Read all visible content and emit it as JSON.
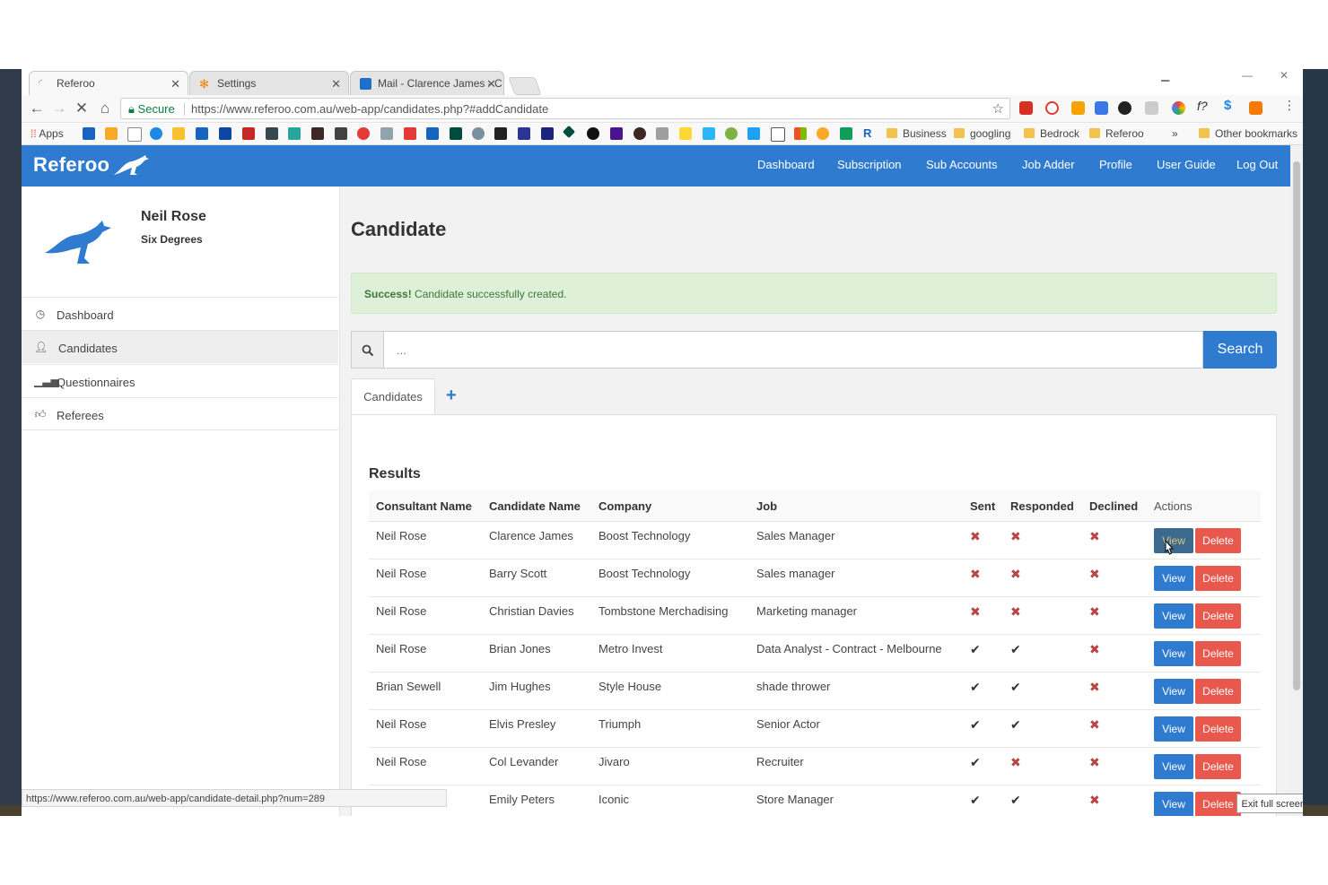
{
  "browser": {
    "tabs": [
      {
        "title": "Referoo",
        "active": true
      },
      {
        "title": "Settings",
        "active": false
      },
      {
        "title": "Mail - Clarence James - C",
        "active": false
      }
    ],
    "secure_label": "Secure",
    "url": "https://www.referoo.com.au/web-app/candidates.php?#addCandidate",
    "bookmarks": {
      "apps_label": "Apps",
      "folders": [
        "Business",
        "googling",
        "Bedrock",
        "Referoo"
      ],
      "overflow": "»",
      "other": "Other bookmarks"
    },
    "status_url": "https://www.referoo.com.au/web-app/candidate-detail.php?num=289",
    "exit_fullscreen": "Exit full screen (f)"
  },
  "app": {
    "logo_text": "Referoo",
    "brand_color": "#2e7bcf",
    "nav": [
      "Dashboard",
      "Subscription",
      "Sub Accounts",
      "Job Adder",
      "Profile",
      "User Guide",
      "Log Out"
    ]
  },
  "sidebar": {
    "user_name": "Neil Rose",
    "user_org": "Six Degrees",
    "items": [
      {
        "label": "Dashboard",
        "icon": "dashboard-icon",
        "active": false
      },
      {
        "label": "Candidates",
        "icon": "user-icon",
        "active": true
      },
      {
        "label": "Questionnaires",
        "icon": "bar-chart-icon",
        "active": false
      },
      {
        "label": "Referees",
        "icon": "thumbs-up-icon",
        "active": false
      }
    ]
  },
  "main": {
    "title": "Candidate",
    "alert": {
      "strong": "Success!",
      "text": " Candidate successfully created."
    },
    "search": {
      "placeholder": "...",
      "button": "Search"
    },
    "tab_label": "Candidates",
    "add_tab": "+",
    "results_title": "Results",
    "columns": [
      "Consultant Name",
      "Candidate Name",
      "Company",
      "Job",
      "Sent",
      "Responded",
      "Declined",
      "Actions"
    ],
    "view_label": "View",
    "delete_label": "Delete",
    "rows": [
      {
        "consultant": "Neil Rose",
        "candidate": "Clarence James",
        "company": "Boost Technology",
        "job": "Sales Manager",
        "sent": false,
        "responded": false,
        "declined": false
      },
      {
        "consultant": "Neil Rose",
        "candidate": "Barry Scott",
        "company": "Boost Technology",
        "job": "Sales manager",
        "sent": false,
        "responded": false,
        "declined": false
      },
      {
        "consultant": "Neil Rose",
        "candidate": "Christian Davies",
        "company": "Tombstone Merchadising",
        "job": "Marketing manager",
        "sent": false,
        "responded": false,
        "declined": false
      },
      {
        "consultant": "Neil Rose",
        "candidate": "Brian Jones",
        "company": "Metro Invest",
        "job": "Data Analyst - Contract - Melbourne",
        "sent": true,
        "responded": true,
        "declined": false
      },
      {
        "consultant": "Brian Sewell",
        "candidate": "Jim Hughes",
        "company": "Style House",
        "job": "shade thrower",
        "sent": true,
        "responded": true,
        "declined": false
      },
      {
        "consultant": "Neil Rose",
        "candidate": "Elvis Presley",
        "company": "Triumph",
        "job": "Senior Actor",
        "sent": true,
        "responded": true,
        "declined": false
      },
      {
        "consultant": "Neil Rose",
        "candidate": "Col Levander",
        "company": "Jivaro",
        "job": "Recruiter",
        "sent": true,
        "responded": false,
        "declined": false
      },
      {
        "consultant": "",
        "candidate": "Emily Peters",
        "company": "Iconic",
        "job": "Store Manager",
        "sent": true,
        "responded": true,
        "declined": false
      }
    ]
  }
}
